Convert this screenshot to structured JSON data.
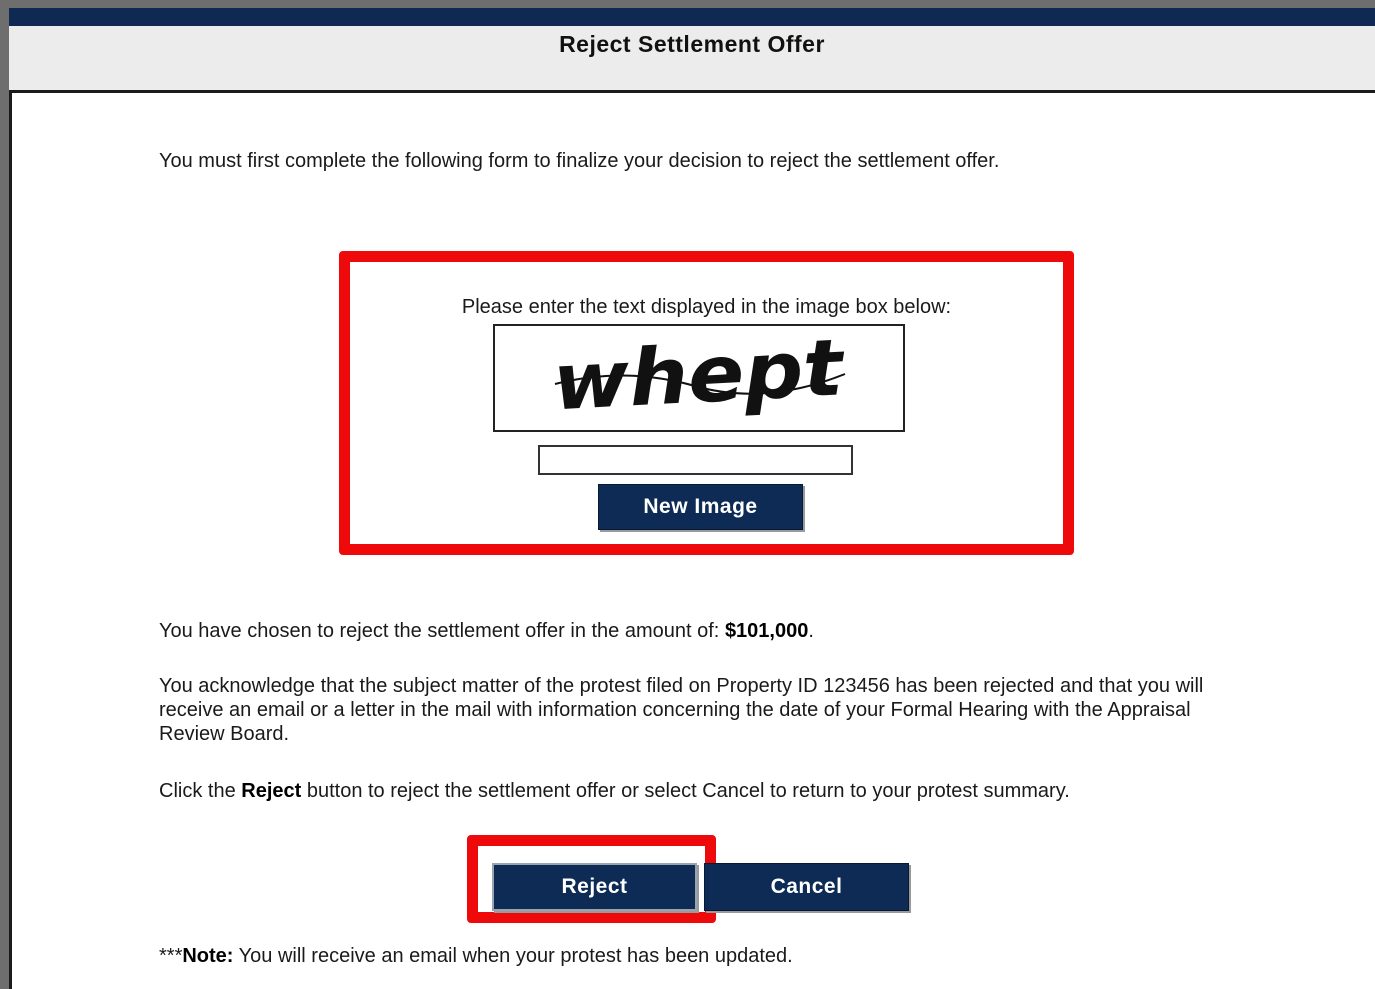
{
  "dialog": {
    "title": "Reject Settlement Offer"
  },
  "intro": {
    "text": "You must first complete the following form to finalize your decision to reject the settlement offer."
  },
  "captcha": {
    "prompt": "Please enter the text displayed in the image box below:",
    "image_text": "whept",
    "input_value": "",
    "new_image_label": "New Image"
  },
  "offer": {
    "amount_prefix": "You have chosen to reject the settlement offer in the amount of:",
    "amount": "$101,000",
    "amount_suffix": "."
  },
  "acknowledgement": {
    "text": "You acknowledge that the subject matter of the protest filed on Property ID 123456 has been rejected and that you will receive an email or a letter in the mail with information concerning the date of your Formal Hearing with the Appraisal Review Board."
  },
  "instructions": {
    "part1": "Click the ",
    "reject_word": "Reject",
    "part2": " button to reject the settlement offer or select Cancel to return to your protest summary."
  },
  "actions": {
    "reject_label": "Reject",
    "cancel_label": "Cancel"
  },
  "note": {
    "prefix": "***",
    "label": "Note:",
    "text": " You will receive an email when your protest has been updated."
  },
  "colors": {
    "header_bar": "#0e2a52",
    "button_bg": "#0d2b55",
    "highlight": "#ee0a0a"
  }
}
